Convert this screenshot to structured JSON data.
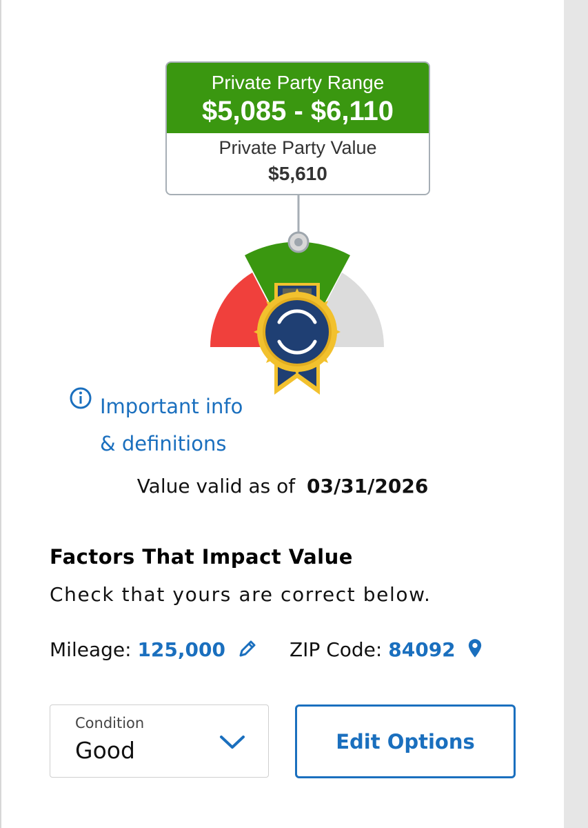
{
  "valuation": {
    "range_label": "Private Party Range",
    "range_values": "$5,085 - $6,110",
    "value_label": "Private Party Value",
    "value_amount": "$5,610"
  },
  "info_link": {
    "line1": "Important info",
    "line2": "& definitions"
  },
  "validity": {
    "label": "Value valid as of",
    "date": "03/31/2026"
  },
  "factors": {
    "title": "Factors That Impact Value",
    "subtitle": "Check that yours are correct below.",
    "mileage_label": "Mileage:",
    "mileage_value": "125,000",
    "zip_label": "ZIP Code:",
    "zip_value": "84092"
  },
  "condition": {
    "label": "Condition",
    "value": "Good"
  },
  "edit_options_label": "Edit Options",
  "colors": {
    "green": "#3a9710",
    "red": "#f0403c",
    "gray": "#dcdcdc",
    "navy": "#1f3f73",
    "gold": "#f2c12e",
    "link_blue": "#1a6fbe"
  },
  "icons": [
    "info-icon",
    "pencil-icon",
    "location-pin-icon",
    "chevron-down-icon",
    "kbb-ribbon-icon"
  ]
}
